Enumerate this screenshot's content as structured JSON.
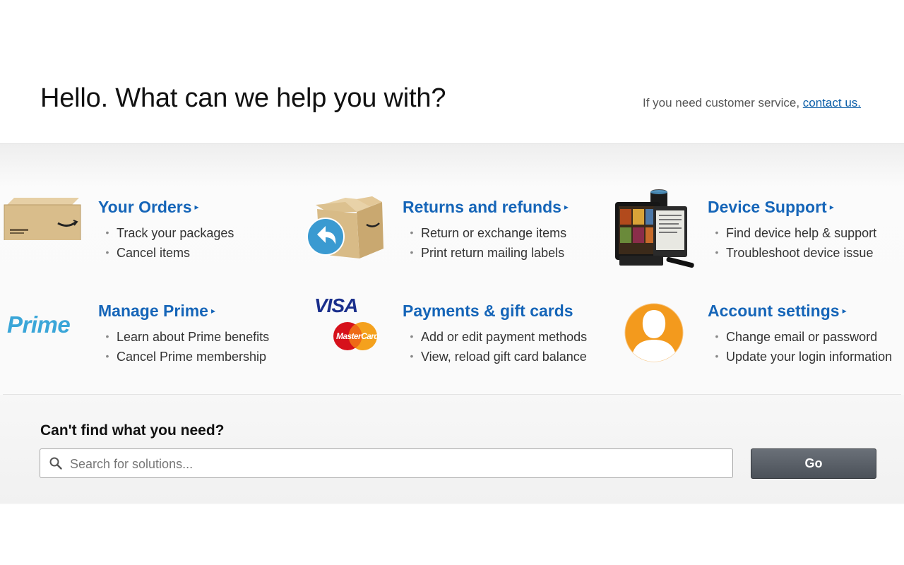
{
  "header": {
    "title": "Hello. What can we help you with?",
    "cs_text": "If you need customer service,",
    "cs_link": "contact us."
  },
  "cards": [
    {
      "title": "Your Orders",
      "icon": "package-box-icon",
      "links": [
        "Track your packages",
        "Cancel items"
      ]
    },
    {
      "title": "Returns and refunds",
      "icon": "return-box-icon",
      "links": [
        "Return or exchange items",
        "Print return mailing labels"
      ]
    },
    {
      "title": "Device Support",
      "icon": "devices-icon",
      "links": [
        "Find device help & support",
        "Troubleshoot device issue"
      ]
    },
    {
      "title": "Manage Prime",
      "icon": "prime-logo",
      "logo_text": "Prime",
      "links": [
        "Learn about Prime benefits",
        "Cancel Prime membership"
      ]
    },
    {
      "title": "Payments & gift cards",
      "icon": "payment-cards-icon",
      "logo_text": "VISA",
      "logo_text_2": "MasterCard",
      "links": [
        "Add or edit payment methods",
        "View, reload gift card balance"
      ]
    },
    {
      "title": "Account settings",
      "icon": "user-avatar-icon",
      "links": [
        "Change email or password",
        "Update your login information"
      ]
    }
  ],
  "search": {
    "heading": "Can't find what you need?",
    "placeholder": "Search for solutions...",
    "button": "Go"
  },
  "colors": {
    "link": "#1565b8",
    "button": "#50565e",
    "avatar": "#f39a1d"
  }
}
